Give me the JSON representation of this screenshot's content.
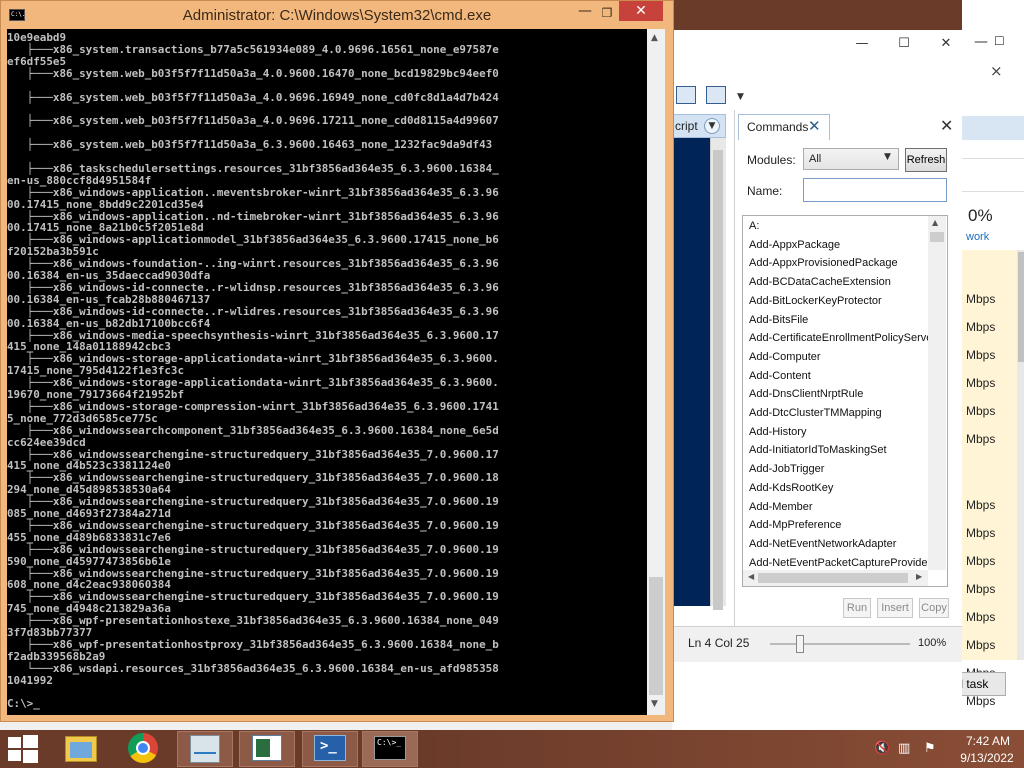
{
  "cmd_window": {
    "title": "Administrator: C:\\Windows\\System32\\cmd.exe",
    "system_icon": "C:\\.",
    "minimize": "—",
    "maximize": "❐",
    "close": "✕",
    "console_lines": [
      "10e9eabd9",
      "   ├───x86_system.transactions_b77a5c561934e089_4.0.9696.16561_none_e97587e",
      "ef6df55e5",
      "   ├───x86_system.web_b03f5f7f11d50a3a_4.0.9600.16470_none_bcd19829bc94eef0",
      "",
      "   ├───x86_system.web_b03f5f7f11d50a3a_4.0.9696.16949_none_cd0fc8d1a4d7b424",
      "",
      "   ├───x86_system.web_b03f5f7f11d50a3a_4.0.9696.17211_none_cd0d8115a4d99607",
      "",
      "   ├───x86_system.web_b03f5f7f11d50a3a_6.3.9600.16463_none_1232fac9da9df43",
      "",
      "   ├───x86_taskschedulersettings.resources_31bf3856ad364e35_6.3.9600.16384_",
      "en-us_880ccf8d4951584f",
      "   ├───x86_windows-application..meventsbroker-winrt_31bf3856ad364e35_6.3.96",
      "00.17415_none_8bdd9c2201cd35e4",
      "   ├───x86_windows-application..nd-timebroker-winrt_31bf3856ad364e35_6.3.96",
      "00.17415_none_8a21b0c5f2051e8d",
      "   ├───x86_windows-applicationmodel_31bf3856ad364e35_6.3.9600.17415_none_b6",
      "f20152ba3b591c",
      "   ├───x86_windows-foundation-..ing-winrt.resources_31bf3856ad364e35_6.3.96",
      "00.16384_en-us_35daeccad9030dfa",
      "   ├───x86_windows-id-connecte..r-wlidnsp.resources_31bf3856ad364e35_6.3.96",
      "00.16384_en-us_fcab28b880467137",
      "   ├───x86_windows-id-connecte..r-wlidres.resources_31bf3856ad364e35_6.3.96",
      "00.16384_en-us_b82db17100bcc6f4",
      "   ├───x86_windows-media-speechsynthesis-winrt_31bf3856ad364e35_6.3.9600.17",
      "415_none_148a01188942cbc3",
      "   ├───x86_windows-storage-applicationdata-winrt_31bf3856ad364e35_6.3.9600.",
      "17415_none_795d4122f1e3fc3c",
      "   ├───x86_windows-storage-applicationdata-winrt_31bf3856ad364e35_6.3.9600.",
      "19670_none_79173664f21952bf",
      "   ├───x86_windows-storage-compression-winrt_31bf3856ad364e35_6.3.9600.1741",
      "5_none_772d3d6585ce775c",
      "   ├───x86_windowssearchcomponent_31bf3856ad364e35_6.3.9600.16384_none_6e5d",
      "cc624ee39dcd",
      "   ├───x86_windowssearchengine-structuredquery_31bf3856ad364e35_7.0.9600.17",
      "415_none_d4b523c3381124e0",
      "   ├───x86_windowssearchengine-structuredquery_31bf3856ad364e35_7.0.9600.18",
      "294_none_d45d898538530a64",
      "   ├───x86_windowssearchengine-structuredquery_31bf3856ad364e35_7.0.9600.19",
      "085_none_d4693f27384a271d",
      "   ├───x86_windowssearchengine-structuredquery_31bf3856ad364e35_7.0.9600.19",
      "455_none_d489b6833831c7e6",
      "   ├───x86_windowssearchengine-structuredquery_31bf3856ad364e35_7.0.9600.19",
      "590_none_d45977473856b61e",
      "   ├───x86_windowssearchengine-structuredquery_31bf3856ad364e35_7.0.9600.19",
      "608_none_d4c2eac938060384",
      "   ├───x86_windowssearchengine-structuredquery_31bf3856ad364e35_7.0.9600.19",
      "745_none_d4948c213829a36a",
      "   ├───x86_wpf-presentationhostexe_31bf3856ad364e35_6.3.9600.16384_none_049",
      "3f7d83bb77377",
      "   ├───x86_wpf-presentationhostproxy_31bf3856ad364e35_6.3.9600.16384_none_b",
      "f2adb339568b2a9",
      "   └───x86_wsdapi.resources_31bf3856ad364e35_6.3.9600.16384_en-us_afd985358",
      "1041992",
      "",
      "C:\\>_"
    ]
  },
  "ise": {
    "minimize": "—",
    "maximize": "☐",
    "close": "✕",
    "help_close": "×",
    "script_tab": "cript",
    "commands_pane": {
      "tab_label": "Commands",
      "tab_close": "✕",
      "pane_close": "✕",
      "modules_label": "Modules:",
      "modules_value": "All",
      "refresh_label": "Refresh",
      "name_label": "Name:",
      "name_value": "",
      "commands": [
        "A:",
        "Add-AppxPackage",
        "Add-AppxProvisionedPackage",
        "Add-BCDataCacheExtension",
        "Add-BitLockerKeyProtector",
        "Add-BitsFile",
        "Add-CertificateEnrollmentPolicyServe",
        "Add-Computer",
        "Add-Content",
        "Add-DnsClientNrptRule",
        "Add-DtcClusterTMMapping",
        "Add-History",
        "Add-InitiatorIdToMaskingSet",
        "Add-JobTrigger",
        "Add-KdsRootKey",
        "Add-Member",
        "Add-MpPreference",
        "Add-NetEventNetworkAdapter",
        "Add-NetEventPacketCaptureProvider"
      ],
      "run_label": "Run",
      "insert_label": "Insert",
      "copy_label": "Copy"
    },
    "status": {
      "ln_col": "Ln 4  Col 25",
      "zoom": "100%"
    }
  },
  "task_manager": {
    "minimize": "—",
    "maximize": "☐",
    "network_percent": "0%",
    "network_label": "work",
    "rows": [
      "Mbps",
      "Mbps",
      "Mbps",
      "Mbps",
      "Mbps",
      "Mbps",
      "Mbps",
      "Mbps",
      "Mbps",
      "Mbps",
      "Mbps",
      "Mbps",
      "Mbps",
      "Mbps",
      "Mbps",
      "Mbps"
    ],
    "end_task_label": "End task"
  },
  "taskbar": {
    "clock_time": "7:42 AM",
    "clock_date": "9/13/2022",
    "ps_glyph": ">_",
    "cmd_glyph": "C:\\>_",
    "icons": {
      "start": "windows-logo-icon",
      "explorer": "file-explorer-icon",
      "chrome": "chrome-icon",
      "perf": "performance-monitor-icon",
      "rdp": "remote-desktop-icon",
      "powershell": "powershell-icon",
      "cmd": "command-prompt-icon",
      "mute": "speaker-muted-icon",
      "network": "network-icon",
      "flag": "action-center-flag-icon"
    },
    "tray": {
      "mute": "🔇",
      "network": "▥",
      "flag": "⚑"
    }
  },
  "colors": {
    "cmd_frame": "#f2b77c",
    "cmd_close": "#c7423a",
    "console_bg": "#000000",
    "console_text": "#c0c0c0",
    "desktop": "#6b3b2a",
    "ise_editor": "#012456",
    "tm_highlight": "#fff5d6"
  }
}
